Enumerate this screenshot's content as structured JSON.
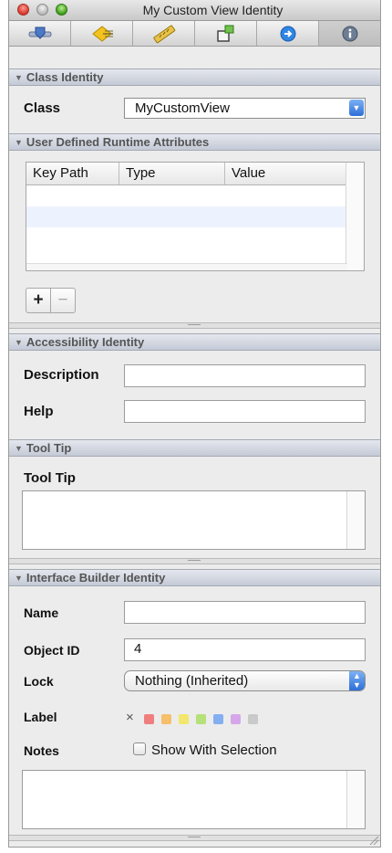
{
  "window": {
    "title": "My Custom View Identity"
  },
  "toolbar": {
    "icons": [
      "attributes-inspector-icon",
      "connections-inspector-icon",
      "size-inspector-icon",
      "bindings-inspector-icon",
      "effects-inspector-icon",
      "identity-inspector-icon"
    ]
  },
  "class_identity": {
    "header": "Class Identity",
    "class_label": "Class",
    "class_value": "MyCustomView"
  },
  "runtime_attributes": {
    "header": "User Defined Runtime Attributes",
    "columns": [
      "Key Path",
      "Type",
      "Value"
    ],
    "add_label": "+",
    "remove_label": "−"
  },
  "accessibility": {
    "header": "Accessibility Identity",
    "description_label": "Description",
    "description_value": "",
    "help_label": "Help",
    "help_value": ""
  },
  "tooltip": {
    "header": "Tool Tip",
    "label": "Tool Tip",
    "value": ""
  },
  "ib_identity": {
    "header": "Interface Builder Identity",
    "name_label": "Name",
    "name_value": "",
    "object_id_label": "Object ID",
    "object_id_value": "4",
    "lock_label": "Lock",
    "lock_value": "Nothing (Inherited)",
    "label_label": "Label",
    "label_clear": "×",
    "label_colors": [
      "#f07e7e",
      "#f6bf6a",
      "#f2e66c",
      "#b6e07a",
      "#84aef2",
      "#d6a6ea",
      "#c9c9c9"
    ],
    "notes_label": "Notes",
    "show_with_selection": "Show With Selection",
    "notes_value": ""
  },
  "accent_color": "#2e6fd8"
}
